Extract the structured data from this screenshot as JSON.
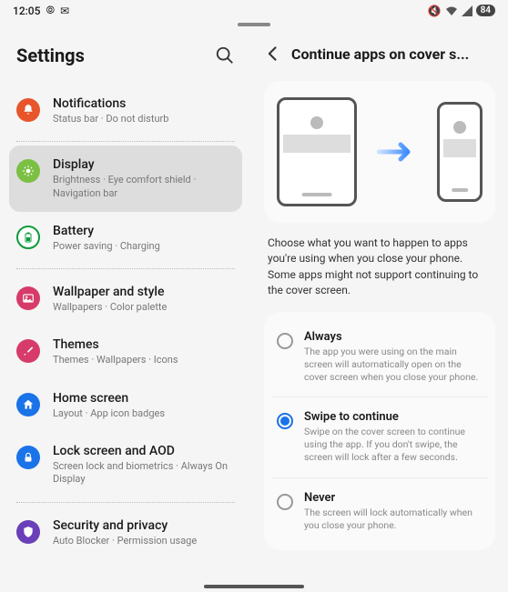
{
  "status": {
    "time": "12:05",
    "battery": "84"
  },
  "settings": {
    "title": "Settings",
    "items": [
      {
        "title": "Notifications",
        "sub": "Status bar · Do not disturb",
        "color": "#e8552b"
      },
      {
        "title": "Display",
        "sub": "Brightness · Eye comfort shield · Navigation bar",
        "color": "#7bc043"
      },
      {
        "title": "Battery",
        "sub": "Power saving · Charging",
        "color": "#0d9a3a"
      },
      {
        "title": "Wallpaper and style",
        "sub": "Wallpapers · Color palette",
        "color": "#d63b6a"
      },
      {
        "title": "Themes",
        "sub": "Themes · Wallpapers · Icons",
        "color": "#d63b6a"
      },
      {
        "title": "Home screen",
        "sub": "Layout · App icon badges",
        "color": "#1a73e8"
      },
      {
        "title": "Lock screen and AOD",
        "sub": "Screen lock and biometrics · Always On Display",
        "color": "#1a73e8"
      },
      {
        "title": "Security and privacy",
        "sub": "Auto Blocker · Permission usage",
        "color": "#6b3fb8"
      }
    ]
  },
  "rightPane": {
    "title": "Continue apps on cover s...",
    "desc": "Choose what you want to happen to apps you're using when you close your phone. Some apps might not support continuing to the cover screen.",
    "options": [
      {
        "title": "Always",
        "sub": "The app you were using on the main screen will automatically open on the cover screen when you close your phone.",
        "selected": false
      },
      {
        "title": "Swipe to continue",
        "sub": "Swipe on the cover screen to continue using the app. If you don't swipe, the screen will lock after a few seconds.",
        "selected": true
      },
      {
        "title": "Never",
        "sub": "The screen will lock automatically when you close your phone.",
        "selected": false
      }
    ]
  }
}
